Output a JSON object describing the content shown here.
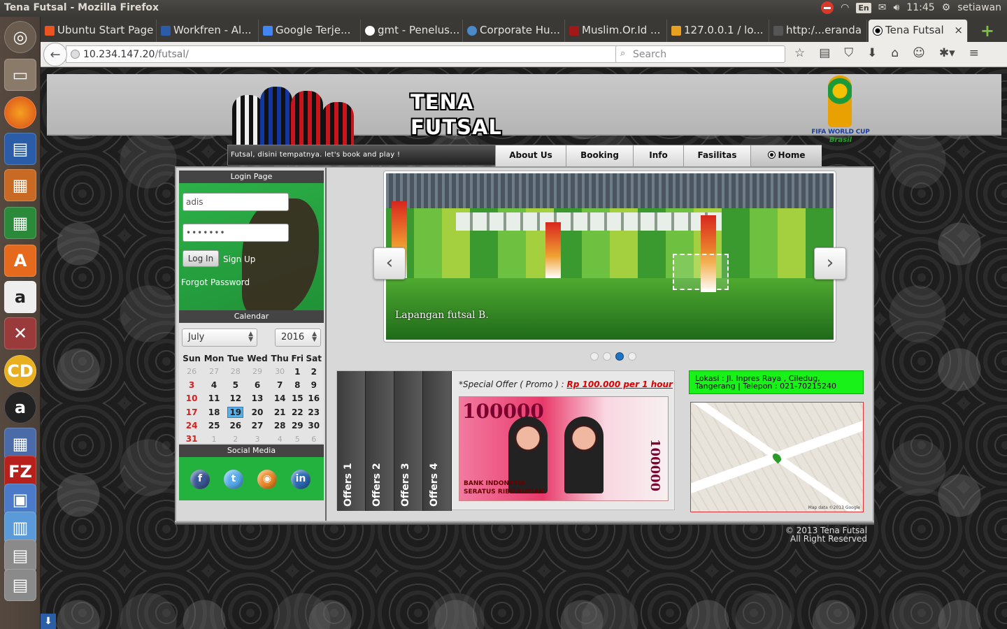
{
  "window_title": "Tena Futsal - Mozilla Firefox",
  "system_tray": {
    "keyboard": "En",
    "time": "11:45",
    "user": "setiawan"
  },
  "tabs": [
    {
      "label": "Ubuntu Start Page"
    },
    {
      "label": "Workfren - Al..."
    },
    {
      "label": "Google Terje..."
    },
    {
      "label": "gmt - Penelus..."
    },
    {
      "label": "Corporate Hu..."
    },
    {
      "label": "Muslim.Or.Id ..."
    },
    {
      "label": "127.0.0.1 / lo..."
    },
    {
      "label": "http:/...eranda"
    },
    {
      "label": "Tena Futsal"
    }
  ],
  "navbar": {
    "url_host": "10.234.147.20",
    "url_path": "/futsal/",
    "search_placeholder": "Search"
  },
  "site": {
    "logo_line1": "TENA",
    "logo_line2": "FUTSAL",
    "wc_title": "FIFA WORLD CUP",
    "wc_sub": "Brasil",
    "tagline": "Futsal, disini tempatnya. let's book and play !",
    "menu": [
      "About Us",
      "Booking",
      "Info",
      "Fasilitas",
      "Home"
    ]
  },
  "login": {
    "heading": "Login Page",
    "username_value": "adis",
    "password_value": "•••••••",
    "login_label": "Log In",
    "signup_label": "Sign Up",
    "forgot_label": "Forgot Password"
  },
  "calendar": {
    "heading": "Calendar",
    "month": "July",
    "year": "2016",
    "weekdays": [
      "Sun",
      "Mon",
      "Tue",
      "Wed",
      "Thu",
      "Fri",
      "Sat"
    ],
    "weeks": [
      [
        "26",
        "27",
        "28",
        "29",
        "30",
        "1",
        "2"
      ],
      [
        "3",
        "4",
        "5",
        "6",
        "7",
        "8",
        "9"
      ],
      [
        "10",
        "11",
        "12",
        "13",
        "14",
        "15",
        "16"
      ],
      [
        "17",
        "18",
        "19",
        "20",
        "21",
        "22",
        "23"
      ],
      [
        "24",
        "25",
        "26",
        "27",
        "28",
        "29",
        "30"
      ],
      [
        "31",
        "1",
        "2",
        "3",
        "4",
        "5",
        "6"
      ]
    ],
    "today": "19"
  },
  "social": {
    "heading": "Social Media",
    "icons": [
      "facebook-icon",
      "twitter-icon",
      "rss-icon",
      "linkedin-icon"
    ]
  },
  "slider": {
    "caption": "Lapangan futsal B.",
    "slide_count": 4,
    "active_slide": 3
  },
  "offers": {
    "tabs": [
      "Offers 1",
      "Offers 2",
      "Offers 3",
      "Offers 4"
    ],
    "promo_text": "*Special Offer ( Promo ) : ",
    "promo_price": "Rp 100.000 per 1 hour",
    "banknote_amount": "100000",
    "banknote_bank": "BANK INDONESIA",
    "banknote_words": "SERATUS RIBU RUPIAH"
  },
  "location": {
    "text": "Lokasi : Jl. Inpres Raya , Ciledug, Tangerang | Telepon : 021-70215240",
    "map_copyright": "Map data ©2013 Google"
  },
  "footer": {
    "line1": "© 2013 Tena Futsal",
    "line2": "All Right Reserved"
  },
  "colors": {
    "accent_green": "#23b23e",
    "address_green": "#19f219",
    "price_red": "#dd0000",
    "active_dot": "#1e74c0"
  }
}
